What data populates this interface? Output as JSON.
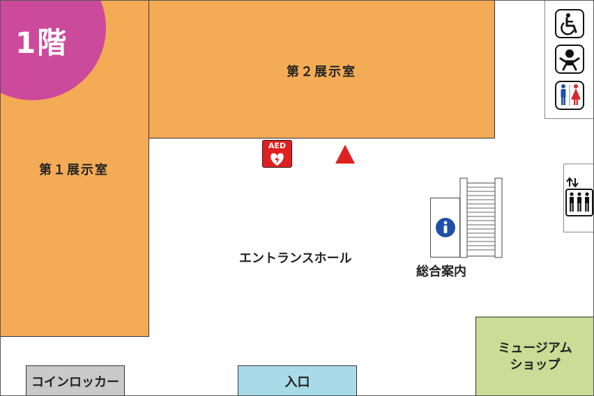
{
  "floor": {
    "label": "1階",
    "color": "#cc4a9b"
  },
  "rooms": {
    "exhibition_1": {
      "label": "第１展示室",
      "color": "#f4ab55"
    },
    "exhibition_2": {
      "label": "第２展示室",
      "color": "#f4ab55"
    },
    "entrance_hall": {
      "label": "エントランスホール"
    },
    "information": {
      "label": "総合案内"
    },
    "museum_shop": {
      "label": "ミュージアム\nショップ",
      "color": "#c9dd97"
    },
    "coin_locker": {
      "label": "コインロッカー",
      "color": "#c9c9c9"
    },
    "entrance": {
      "label": "入口",
      "color": "#a8dbe7"
    }
  },
  "icons": {
    "aed": {
      "text": "AED",
      "color": "#e02020"
    },
    "current_location_color": "#e02020",
    "info_color": "#1f4fa8",
    "male_color": "#1f4fa8",
    "female_color": "#d42a2a",
    "names": [
      "wheelchair-icon",
      "baby-changing-icon",
      "restroom-icon",
      "elevator-icon",
      "info-icon",
      "aed-icon",
      "current-location-icon",
      "escalator-icon"
    ]
  }
}
